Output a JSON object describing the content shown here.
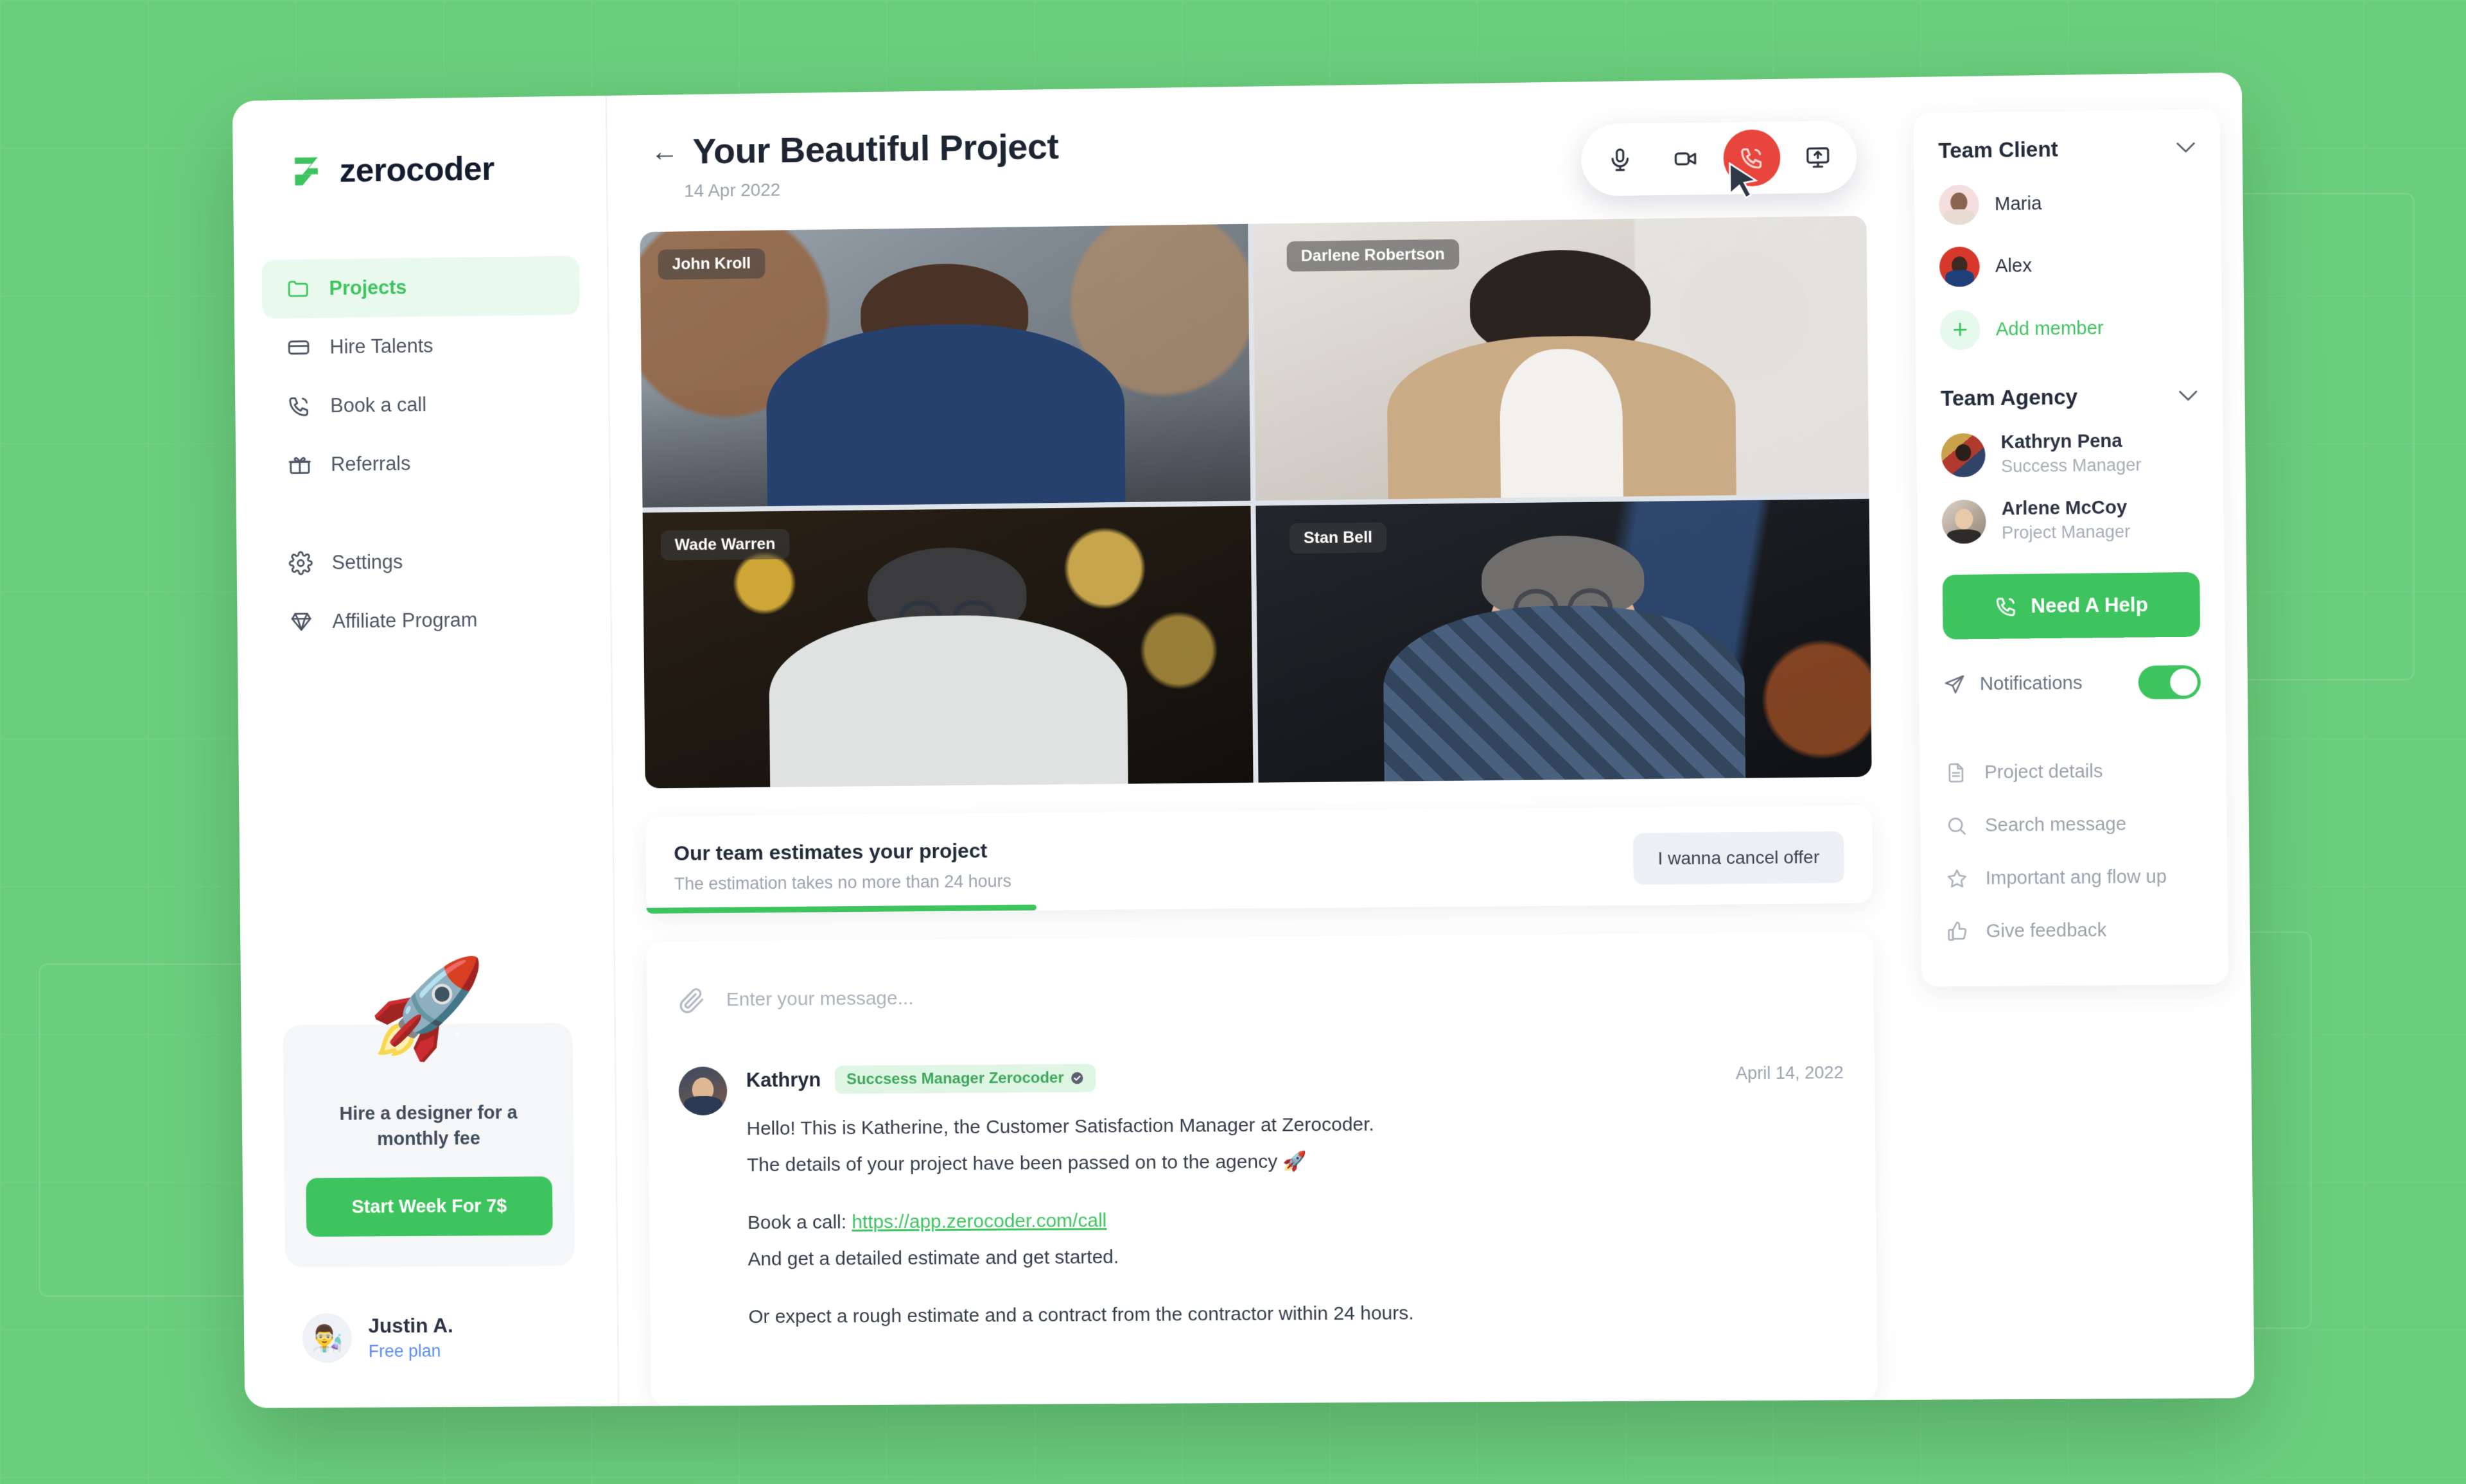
{
  "theme": {
    "background_green": "#6ace7c",
    "accent_green": "#3ec45f",
    "danger_red": "#e8453c",
    "link_blue": "#5b8def",
    "text_dark": "#1d2533"
  },
  "brand": {
    "name": "zerocoder",
    "logo_icon": "zerocoder-logo-icon"
  },
  "sidebar": {
    "items": [
      {
        "label": "Projects",
        "icon": "folder-icon",
        "active": true
      },
      {
        "label": "Hire Talents",
        "icon": "card-icon",
        "active": false
      },
      {
        "label": "Book a call",
        "icon": "phone-icon",
        "active": false
      },
      {
        "label": "Referrals",
        "icon": "gift-icon",
        "active": false
      },
      {
        "label": "Settings",
        "icon": "gear-icon",
        "active": false
      },
      {
        "label": "Affiliate Program",
        "icon": "diamond-icon",
        "active": false
      }
    ],
    "promo": {
      "illustration": "rocket-icon",
      "text": "Hire a designer for a monthly fee",
      "button_label": "Start Week For 7$"
    },
    "profile": {
      "avatar": "user-avatar",
      "name": "Justin A.",
      "plan": "Free plan"
    }
  },
  "header": {
    "back_icon": "back-arrow-icon",
    "title": "Your Beautiful Project",
    "date": "14 Apr 2022",
    "controls": [
      {
        "name": "microphone-button",
        "icon": "microphone-icon",
        "variant": "default"
      },
      {
        "name": "camera-button",
        "icon": "video-camera-icon",
        "variant": "default"
      },
      {
        "name": "end-call-button",
        "icon": "phone-hangup-icon",
        "variant": "danger"
      },
      {
        "name": "share-screen-button",
        "icon": "screen-share-icon",
        "variant": "default"
      }
    ]
  },
  "video_grid": {
    "participants": [
      {
        "name": "John Kroll"
      },
      {
        "name": "Darlene Robertson"
      },
      {
        "name": "Wade Warren"
      },
      {
        "name": "Stan Bell"
      }
    ]
  },
  "estimate": {
    "title": "Our team estimates your project",
    "subtitle": "The estimation takes no more than 24 hours",
    "cancel_label": "I wanna cancel offer",
    "progress_percent": 32
  },
  "chat": {
    "composer": {
      "attach_icon": "paperclip-icon",
      "placeholder": "Enter your message...",
      "value": ""
    },
    "messages": [
      {
        "author": "Kathryn",
        "badge": "Succsess Manager Zerocoder",
        "badge_icon": "verified-icon",
        "time": "April 14, 2022",
        "lines": [
          {
            "type": "text",
            "text": "Hello! This is Katherine, the Customer Satisfaction Manager at Zerocoder."
          },
          {
            "type": "text",
            "text": "The details of your project have been passed on to the agency 🚀"
          },
          {
            "type": "spacer"
          },
          {
            "type": "link_line",
            "prefix": "Book a call: ",
            "link": "https://app.zerocoder.com/call"
          },
          {
            "type": "text",
            "text": "And get a detailed estimate and get started."
          },
          {
            "type": "spacer"
          },
          {
            "type": "text",
            "text": "Or expect a rough estimate and a contract from the contractor within 24 hours."
          }
        ]
      }
    ]
  },
  "right_panel": {
    "team_client": {
      "title": "Team Client",
      "collapse_icon": "chevron-down-icon",
      "members": [
        {
          "name": "Maria"
        },
        {
          "name": "Alex"
        }
      ],
      "add_member_label": "Add member",
      "add_member_icon": "plus-icon"
    },
    "team_agency": {
      "title": "Team Agency",
      "collapse_icon": "chevron-down-icon",
      "members": [
        {
          "name": "Kathryn Pena",
          "role": "Success Manager"
        },
        {
          "name": "Arlene McCoy",
          "role": "Project Manager"
        }
      ]
    },
    "help_button": {
      "label": "Need A Help",
      "icon": "phone-icon"
    },
    "notifications": {
      "label": "Notifications",
      "icon": "send-icon",
      "enabled": true
    },
    "menu": [
      {
        "label": "Project details",
        "icon": "document-icon"
      },
      {
        "label": "Search message",
        "icon": "search-icon"
      },
      {
        "label": "Important ang flow up",
        "icon": "star-icon"
      },
      {
        "label": "Give feedback",
        "icon": "thumbs-up-icon"
      }
    ]
  }
}
